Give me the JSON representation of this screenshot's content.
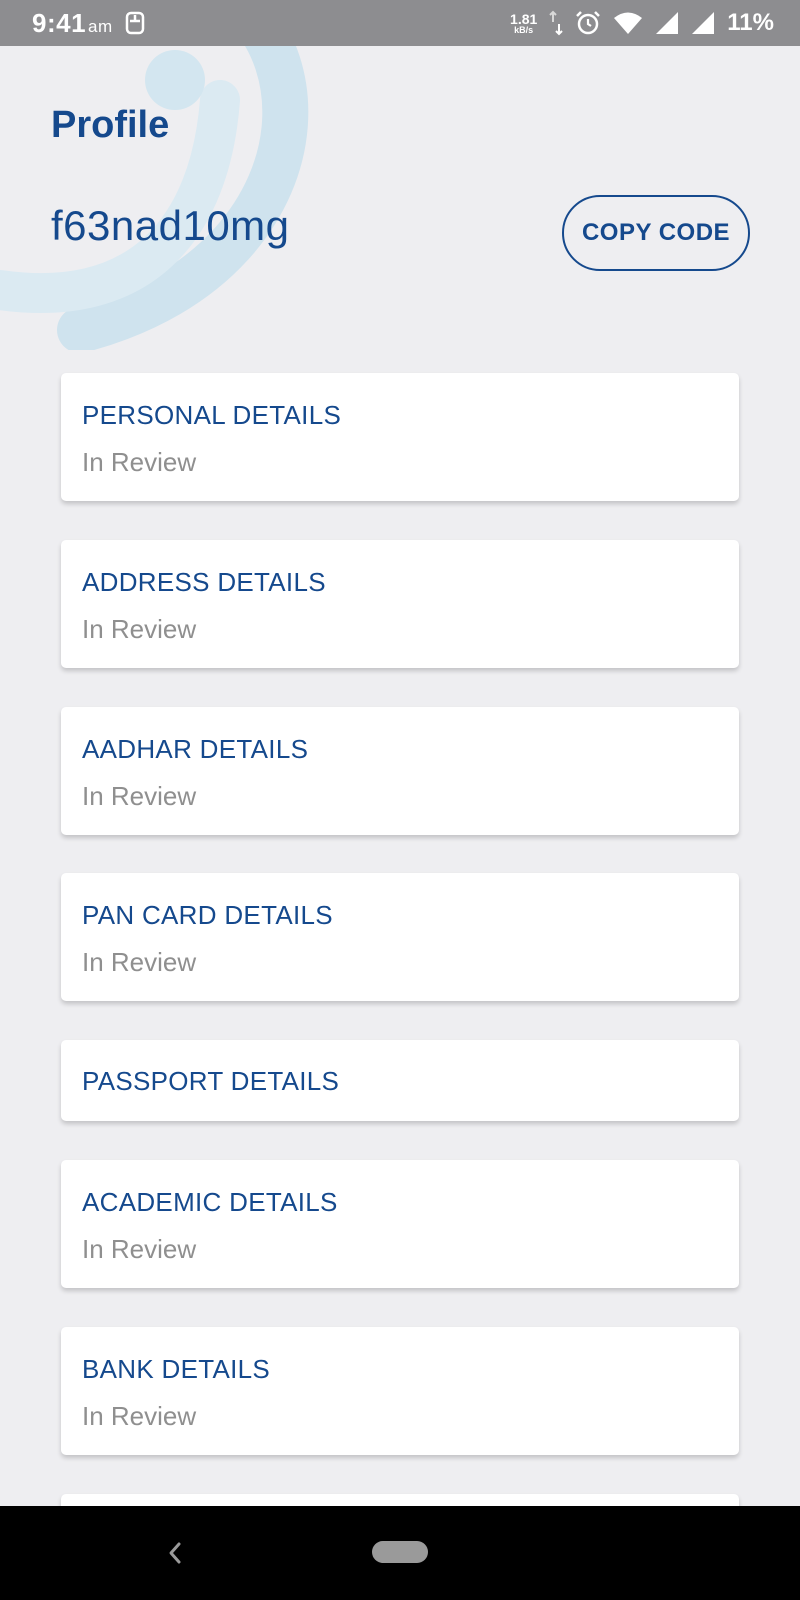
{
  "status_bar": {
    "time": "9:41",
    "ampm": "am",
    "speed_value": "1.81",
    "speed_unit": "kB/s",
    "battery": "11%"
  },
  "header": {
    "title": "Profile",
    "code": "f63nad10mg",
    "copy_button_label": "COPY CODE"
  },
  "cards": [
    {
      "title": "PERSONAL DETAILS",
      "status": "In Review"
    },
    {
      "title": "ADDRESS DETAILS",
      "status": "In Review"
    },
    {
      "title": "AADHAR DETAILS",
      "status": "In Review"
    },
    {
      "title": "PAN CARD DETAILS",
      "status": "In Review"
    },
    {
      "title": "PASSPORT DETAILS",
      "status": ""
    },
    {
      "title": "ACADEMIC DETAILS",
      "status": "In Review"
    },
    {
      "title": "BANK DETAILS",
      "status": "In Review"
    }
  ],
  "colors": {
    "brand_blue": "#15498d",
    "status_gray": "#8f8f8f",
    "background": "#eeeef1"
  },
  "icons": {
    "sim": "sim-card-icon",
    "data_arrows": "data-transfer-icon",
    "alarm": "alarm-icon",
    "wifi": "wifi-icon",
    "signal": "signal-icon",
    "back": "back-icon",
    "home": "home-pill-icon"
  }
}
